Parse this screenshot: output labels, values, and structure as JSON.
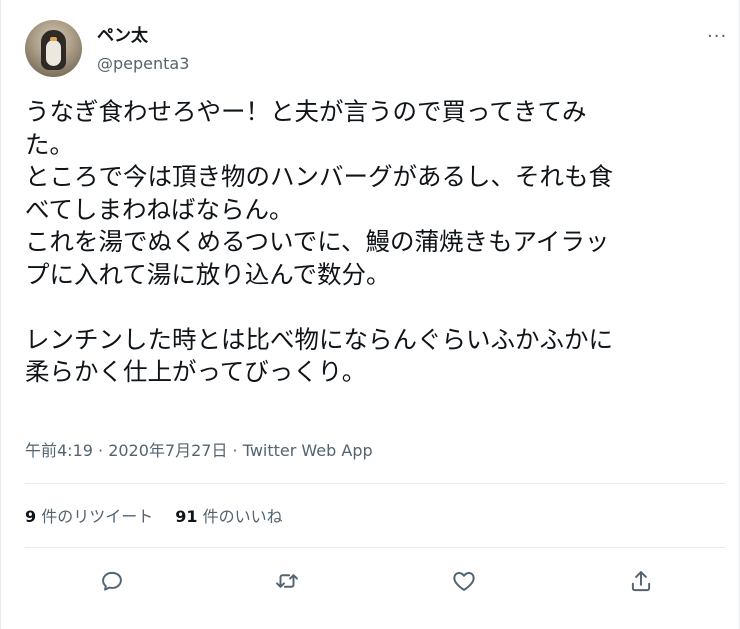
{
  "user": {
    "name": "ペン太",
    "handle": "@pepenta3"
  },
  "menu": {
    "more_label": "···"
  },
  "tweet": {
    "lines": [
      "うなぎ食わせろやー！と夫が言うので買ってきてみ",
      "た。",
      "ところで今は頂き物のハンバーグがあるし、それも食",
      "べてしまわねばならん。",
      "これを湯でぬくめるついでに、鰻の蒲焼きもアイラッ",
      "プに入れて湯に放り込んで数分。",
      "",
      "レンチンした時とは比べ物にならんぐらいふかふかに",
      "柔らかく仕上がってびっくり。"
    ]
  },
  "meta": {
    "text": "午前4:19 · 2020年7月27日 · Twitter Web App"
  },
  "stats": {
    "retweets_count": "9",
    "retweets_label": "件のリツイート",
    "likes_count": "91",
    "likes_label": "件のいいね"
  },
  "actions": {
    "reply_icon": "reply-icon",
    "retweet_icon": "retweet-icon",
    "like_icon": "like-icon",
    "share_icon": "share-icon"
  },
  "colors": {
    "text": "#0f1419",
    "secondary": "#536471",
    "border": "#e6ecf0"
  }
}
